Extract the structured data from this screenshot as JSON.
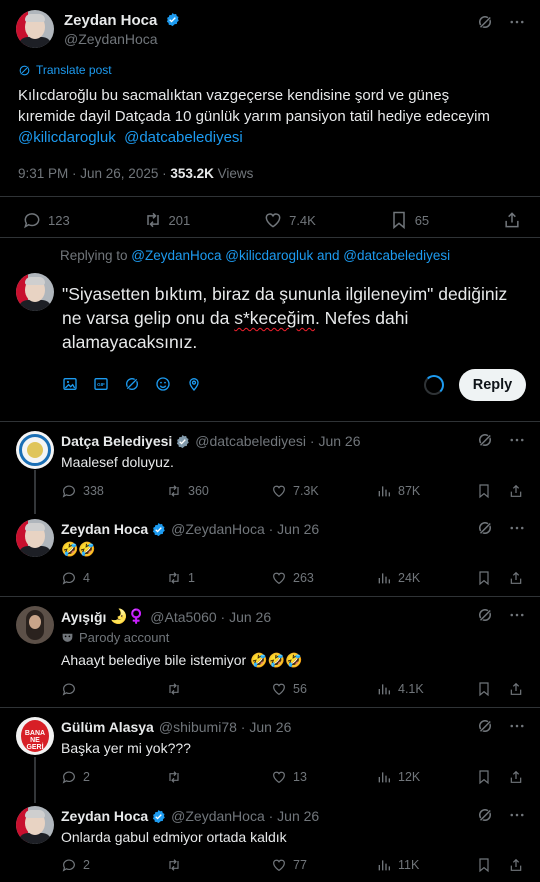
{
  "main_tweet": {
    "display_name": "Zeydan Hoca",
    "handle": "@ZeydanHoca",
    "translate_label": "Translate post",
    "text_line1": "Kılıcdaroğlu bu sacmalıktan  vazgeçerse  kendisine şord ve güneş",
    "text_line2": "kıremide dayil Datçada  10 günlük yarım pansiyon tatil hediye edeceyim",
    "mention1": "@kilicdarogluk",
    "mention2": "@datcabelediyesi",
    "time": "9:31 PM · Jun 26, 2025 · ",
    "views_count": "353.2K",
    "views_label": " Views",
    "replies": "123",
    "reposts": "201",
    "likes": "7.4K",
    "bookmarks": "65"
  },
  "compose": {
    "replying_prefix": "Replying to ",
    "replying_to": "@ZeydanHoca @kilicdarogluk and @datcabelediyesi",
    "text_before": "\"Siyasetten bıktım, biraz da şununla ilgileneyim\" dediğiniz ne varsa gelip onu da ",
    "text_misspelled": "s*keceğim",
    "text_after": ". Nefes dahi alamayacaksınız.",
    "reply_button": "Reply"
  },
  "replies": [
    {
      "name": "Datça Belediyesi",
      "handle": "@datcabelediyesi · Jun 26",
      "text": "Maalesef doluyuz.",
      "replies": "338",
      "reposts": "360",
      "likes": "7.3K",
      "views": "87K"
    },
    {
      "name": "Zeydan Hoca",
      "handle": "@ZeydanHoca · Jun 26",
      "text": "🤣🤣",
      "replies": "4",
      "reposts": "1",
      "likes": "263",
      "views": "24K"
    },
    {
      "name": "Ayışığı",
      "name_emoji": "🌛♀️",
      "handle": "@Ata5060 · Jun 26",
      "parody": "Parody account",
      "text": "Ahaayt belediye  bile istemiyor 🤣🤣🤣",
      "replies": "",
      "reposts": "",
      "likes": "56",
      "views": "4.1K"
    },
    {
      "name": "Gülüm Alasya",
      "handle": "@shibumi78 · Jun 26",
      "text": "Başka yer mi yok???",
      "replies": "2",
      "reposts": "",
      "likes": "13",
      "views": "12K",
      "avatar_text": "BANA NE GERİ"
    },
    {
      "name": "Zeydan Hoca",
      "handle": "@ZeydanHoca · Jun 26",
      "text": "Onlarda gabul edmiyor ortada kaldık",
      "replies": "2",
      "reposts": "",
      "likes": "77",
      "views": "11K"
    }
  ],
  "colors": {
    "accent": "#1d9bf0",
    "background": "#000000",
    "verified": "#1d9bf0",
    "muted": "#71767b",
    "text": "#e7e9ea"
  }
}
